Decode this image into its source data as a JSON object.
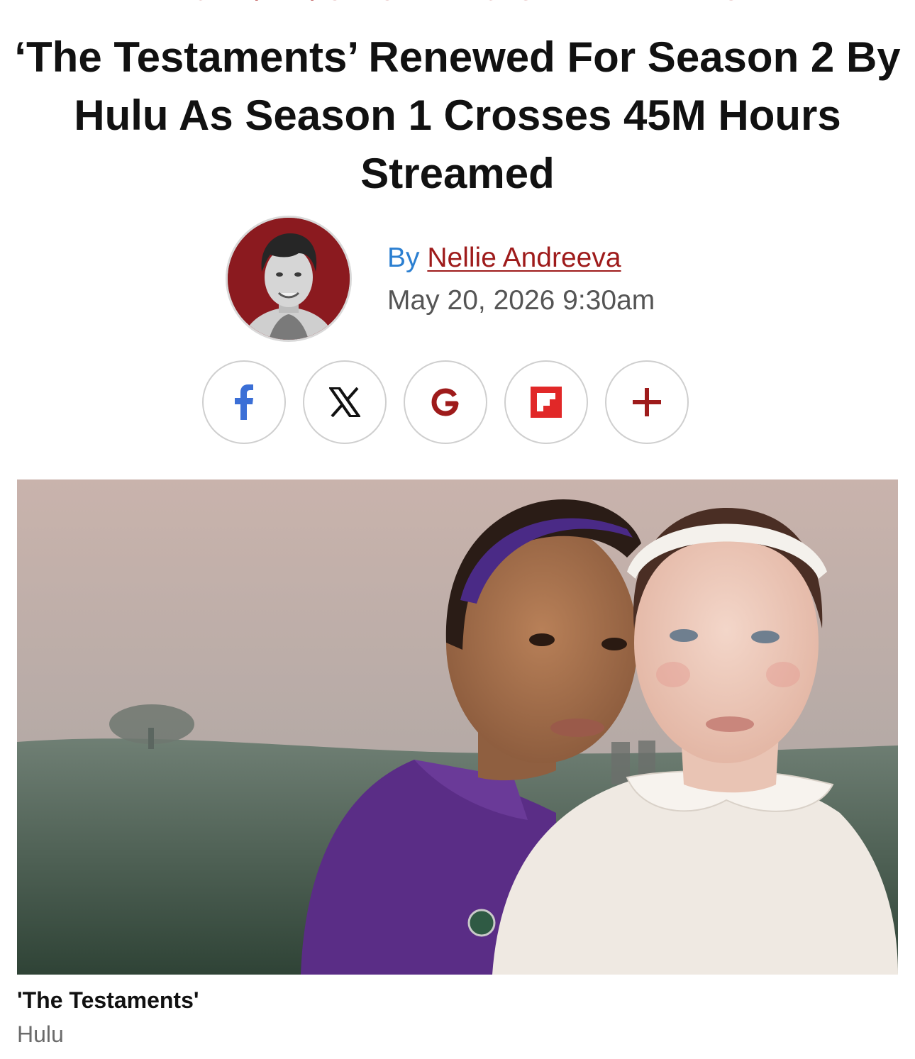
{
  "breadcrumb": "HOME / TV / CANCELLATIONS AND RENEWALS",
  "article": {
    "headline": "‘The Testaments’ Renewed For Season 2 By Hulu As Season 1 Crosses 45M Hours Streamed",
    "byline_prefix": "By",
    "author": "Nellie Andreeva",
    "date": "May 20, 2026 9:30am"
  },
  "share": {
    "items": [
      {
        "icon": "facebook-icon",
        "glyph": "f",
        "color": "#3b6fd6"
      },
      {
        "icon": "x-icon",
        "glyph": "X",
        "color": "#111111"
      },
      {
        "icon": "google-icon",
        "glyph": "G",
        "color": "#9e1b1b"
      },
      {
        "icon": "flipboard-icon",
        "glyph": "F",
        "color": "#e12828"
      },
      {
        "icon": "plus-icon",
        "glyph": "+",
        "color": "#9e1b1b"
      }
    ]
  },
  "image": {
    "caption_title": "'The Testaments'",
    "caption_credit": "Hulu"
  },
  "colors": {
    "accent_red": "#9e1b1b",
    "by_blue": "#2b7fd1",
    "avatar_bg": "#8b1a1f"
  }
}
